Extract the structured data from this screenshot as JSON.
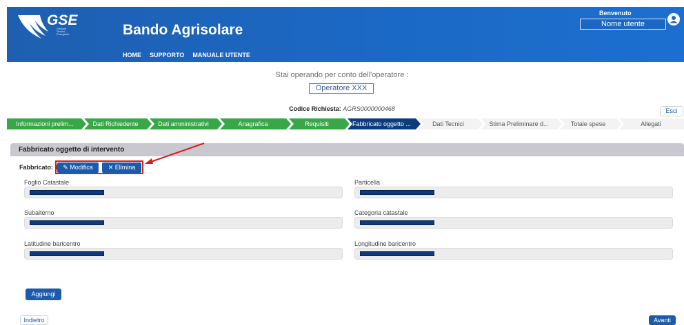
{
  "header": {
    "logo_text": "GSE",
    "logo_sub": "Gestore Servizi Energetici",
    "app_title": "Bando Agrisolare",
    "nav": [
      "HOME",
      "SUPPORTO",
      "MANUALE UTENTE"
    ],
    "welcome": "Benvenuto",
    "user_name": "Nome utente"
  },
  "operator": {
    "label": "Stai operando per conto dell'operatore :",
    "name": "Operatore XXX"
  },
  "request": {
    "label": "Codice Richiesta:",
    "code": "AGRS0000000468"
  },
  "esci_label": "Esci",
  "steps": [
    {
      "label": "Informazioni prelim...",
      "state": "done"
    },
    {
      "label": "Dati Richiedente",
      "state": "done"
    },
    {
      "label": "Dati amministrativi",
      "state": "done"
    },
    {
      "label": "Anagrafica",
      "state": "done"
    },
    {
      "label": "Requisiti",
      "state": "done"
    },
    {
      "label": "Fabbricato oggetto ...",
      "state": "current"
    },
    {
      "label": "Dati Tecnici",
      "state": "todo"
    },
    {
      "label": "Stima Preliminare d...",
      "state": "todo"
    },
    {
      "label": "Totale spese",
      "state": "todo"
    },
    {
      "label": "Allegati",
      "state": "todo"
    }
  ],
  "section": {
    "title": "Fabbricato oggetto di intervento",
    "fabbricato_label": "Fabbricato: 1",
    "modifica_label": "Modifica",
    "elimina_label": "Elimina"
  },
  "fields": [
    {
      "label": "Foglio Catastale",
      "value": "redacted"
    },
    {
      "label": "Particella",
      "value": "redacted"
    },
    {
      "label": "Subalterno",
      "value": "redacted"
    },
    {
      "label": "Categoria catastale",
      "value": "redacted"
    },
    {
      "label": "Latitudine baricentro",
      "value": "redacted"
    },
    {
      "label": "Longitudine baricentro",
      "value": "redacted"
    }
  ],
  "buttons": {
    "aggiungi": "Aggiungi",
    "indietro": "Indietro",
    "avanti": "Avanti"
  },
  "colors": {
    "header_blue": "#1b68c4",
    "step_done": "#3aa64a",
    "step_current": "#0d3b7e",
    "step_todo": "#f3f3f3",
    "button_blue": "#1c5bab",
    "annotation_red": "#d71c1c"
  }
}
